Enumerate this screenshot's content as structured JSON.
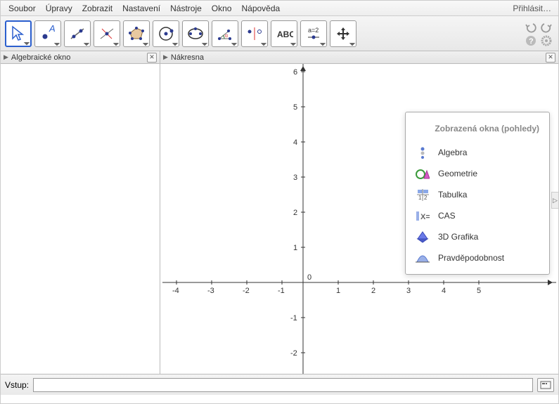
{
  "menu": {
    "items": [
      "Soubor",
      "Úpravy",
      "Zobrazit",
      "Nastavení",
      "Nástroje",
      "Okno",
      "Nápověda"
    ],
    "signin": "Přihlásit…"
  },
  "toolbar": {
    "tools": [
      "move",
      "point",
      "line",
      "perpendicular",
      "polygon",
      "circle",
      "ellipse",
      "angle",
      "reflect",
      "slider-text",
      "slider-ab",
      "move-view"
    ]
  },
  "panels": {
    "algebra_title": "Algebraické okno",
    "graphics_title": "Nákresna"
  },
  "popup": {
    "title": "Zobrazená okna (pohledy)",
    "items": [
      {
        "label": "Algebra"
      },
      {
        "label": "Geometrie"
      },
      {
        "label": "Tabulka"
      },
      {
        "label": "CAS"
      },
      {
        "label": "3D Grafika"
      },
      {
        "label": "Pravděpodobnost"
      }
    ]
  },
  "input": {
    "label": "Vstup:",
    "value": ""
  },
  "chart_data": {
    "type": "scatter",
    "title": "",
    "xlabel": "",
    "ylabel": "",
    "xlim": [
      -5,
      6
    ],
    "ylim": [
      -3,
      6.5
    ],
    "xticks": [
      -4,
      -3,
      -2,
      -1,
      0,
      1,
      2,
      3,
      4,
      5
    ],
    "yticks": [
      -2,
      -1,
      0,
      1,
      2,
      3,
      4,
      5,
      6
    ],
    "series": []
  }
}
